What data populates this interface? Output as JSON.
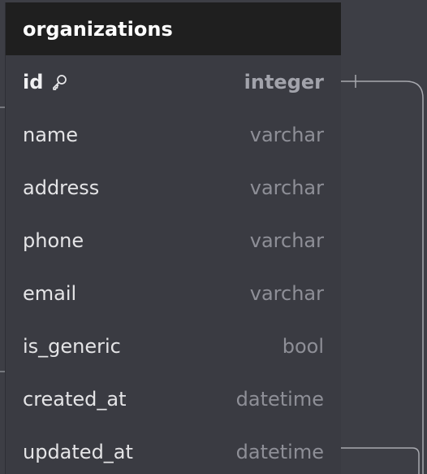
{
  "table": {
    "title": "organizations",
    "columns": [
      {
        "name": "id",
        "type": "integer",
        "primary_key": true
      },
      {
        "name": "name",
        "type": "varchar"
      },
      {
        "name": "address",
        "type": "varchar"
      },
      {
        "name": "phone",
        "type": "varchar"
      },
      {
        "name": "email",
        "type": "varchar"
      },
      {
        "name": "is_generic",
        "type": "bool"
      },
      {
        "name": "created_at",
        "type": "datetime"
      },
      {
        "name": "updated_at",
        "type": "datetime"
      }
    ]
  },
  "colors": {
    "canvas": "#3d3e45",
    "header_bg": "#1f1f1f",
    "table_bg": "#3a3b42",
    "connector": "#a8a9af"
  },
  "icons": {
    "primary_key": "key-icon"
  }
}
